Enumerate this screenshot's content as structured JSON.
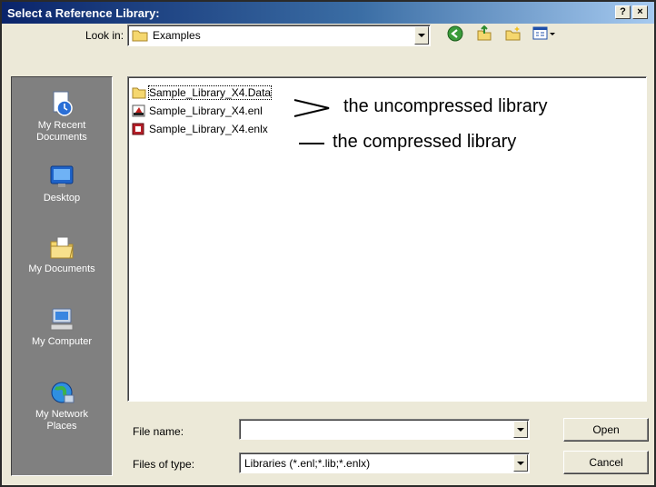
{
  "window": {
    "title": "Select a Reference Library:",
    "help_label": "?",
    "close_label": "×"
  },
  "lookin": {
    "label": "Look in:",
    "value": "Examples",
    "icon": "folder-icon"
  },
  "toolbar": {
    "icons": [
      "back-icon",
      "up-folder-icon",
      "new-folder-icon",
      "views-icon"
    ]
  },
  "places": [
    {
      "label_line1": "My Recent",
      "label_line2": "Documents",
      "icon": "recent-documents-icon"
    },
    {
      "label_line1": "Desktop",
      "label_line2": "",
      "icon": "desktop-icon"
    },
    {
      "label_line1": "My Documents",
      "label_line2": "",
      "icon": "my-documents-icon"
    },
    {
      "label_line1": "My Computer",
      "label_line2": "",
      "icon": "my-computer-icon"
    },
    {
      "label_line1": "My Network",
      "label_line2": "Places",
      "icon": "network-places-icon"
    }
  ],
  "files": [
    {
      "name": "Sample_Library_X4.Data",
      "icon": "folder-icon"
    },
    {
      "name": "Sample_Library_X4.enl",
      "icon": "endnote-library-icon"
    },
    {
      "name": "Sample_Library_X4.enlx",
      "icon": "endnote-compressed-icon"
    }
  ],
  "annotations": {
    "uncompressed": "the uncompressed library",
    "compressed": "the compressed library"
  },
  "filename": {
    "label": "File name:",
    "value": ""
  },
  "filetype": {
    "label": "Files of type:",
    "value": "Libraries (*.enl;*.lib;*.enlx)"
  },
  "buttons": {
    "open": "Open",
    "cancel": "Cancel"
  }
}
